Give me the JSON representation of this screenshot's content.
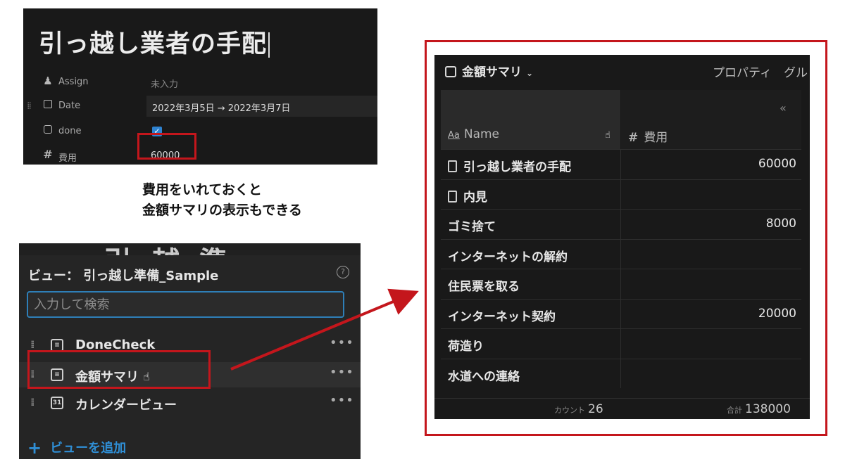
{
  "page": {
    "title": "引っ越し業者の手配",
    "properties": [
      {
        "name": "Assign",
        "value": "未入力",
        "icon": "people-icon"
      },
      {
        "name": "Date",
        "value": "2022年3月5日 → 2022年3月7日",
        "icon": "calendar-icon"
      },
      {
        "name": "done",
        "value": "✓",
        "icon": "checkbox-icon"
      },
      {
        "name": "費用",
        "value": "60000",
        "icon": "number-icon"
      }
    ]
  },
  "caption": {
    "line1": "費用をいれておくと",
    "line2": "金額サマリの表示もできる"
  },
  "views_menu": {
    "title": "ビュー： 引っ越し準備_Sample",
    "search_placeholder": "入力して検索",
    "items": [
      {
        "label": "DoneCheck",
        "icon": "list-view-icon"
      },
      {
        "label": "金額サマリ",
        "icon": "list-view-icon",
        "highlighted": true
      },
      {
        "label": "カレンダービュー",
        "icon": "calendar-view-icon",
        "icon_text": "31"
      }
    ],
    "add_label": "ビューを追加"
  },
  "table": {
    "view_name": "金額サマリ",
    "toolbar_right": "プロパティ　グル",
    "columns": {
      "name": "Name",
      "name_prefix": "Aa",
      "cost": "費用",
      "cost_prefix": "#"
    },
    "rows": [
      {
        "name": "引っ越し業者の手配",
        "cost": "60000",
        "doc": true
      },
      {
        "name": "内見",
        "cost": "",
        "doc": true
      },
      {
        "name": "ゴミ捨て",
        "cost": "8000",
        "doc": false
      },
      {
        "name": "インターネットの解約",
        "cost": "",
        "doc": false
      },
      {
        "name": "住民票を取る",
        "cost": "",
        "doc": false
      },
      {
        "name": "インターネット契約",
        "cost": "20000",
        "doc": false
      },
      {
        "name": "荷造り",
        "cost": "",
        "doc": false
      },
      {
        "name": "水道への連絡",
        "cost": "",
        "doc": false
      }
    ],
    "footer": {
      "count_label": "カウント",
      "count": "26",
      "sum_label": "合計",
      "sum": "138000"
    }
  },
  "colors": {
    "highlight_red": "#c4161c",
    "accent_blue": "#2f8fd6",
    "panel_dark": "#191919"
  }
}
